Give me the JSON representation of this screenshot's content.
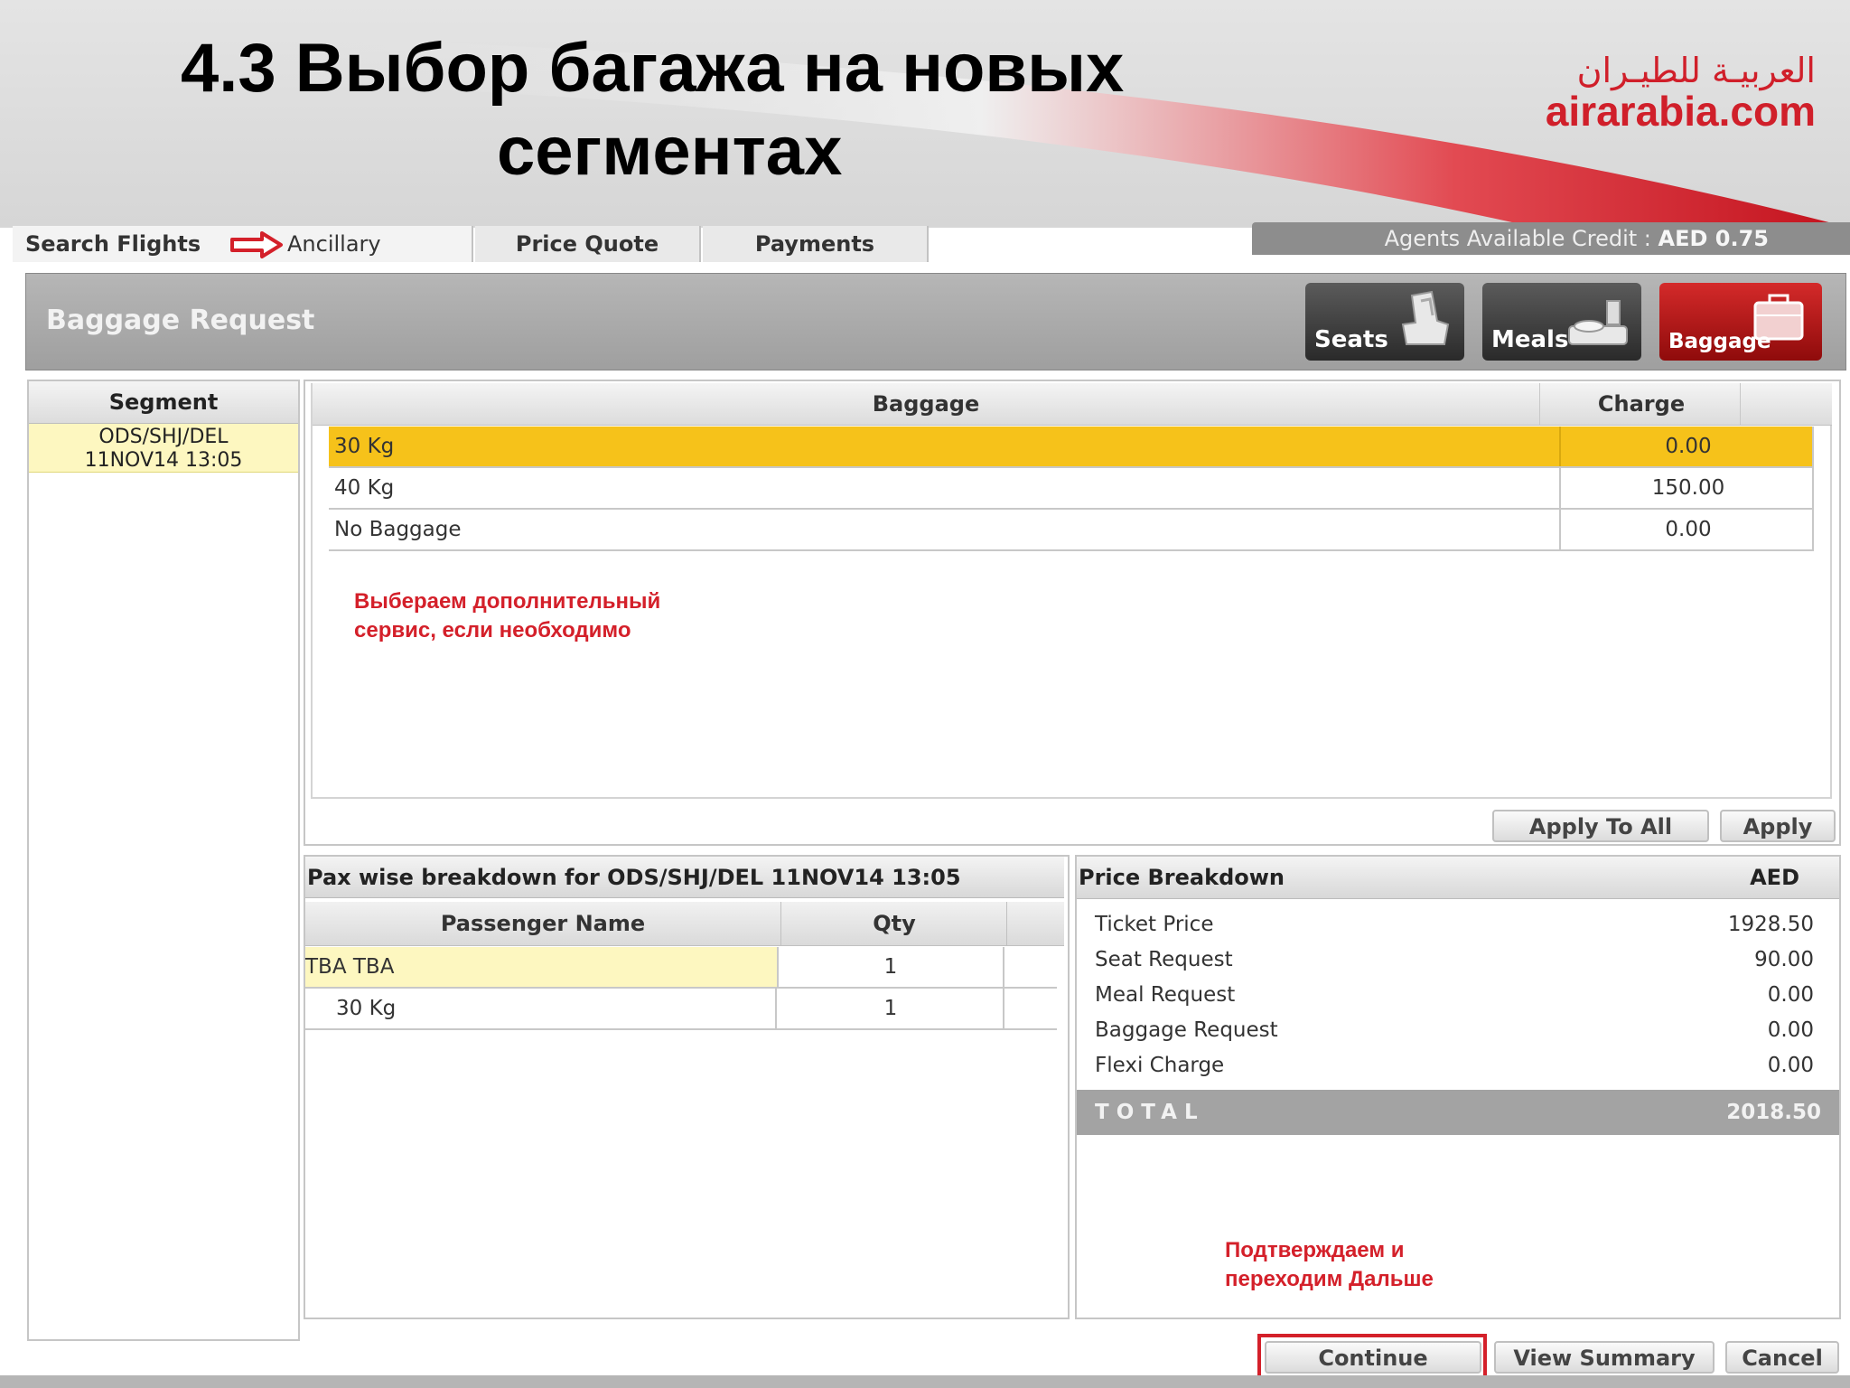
{
  "slide": {
    "title_line1": "4.3 Выбор багажа на новых",
    "title_line2": "сегментах"
  },
  "logo": {
    "arabic": "العربيـة للطيـران",
    "latin": "airarabia.com"
  },
  "tabs": {
    "search_flights": "Search Flights",
    "ancillary": "Ancillary",
    "price_quote": "Price Quote",
    "payments": "Payments"
  },
  "credit": {
    "label": "Agents Available Credit :",
    "value": "AED 0.75"
  },
  "request": {
    "title": "Baggage Request",
    "services": {
      "seats": "Seats",
      "meals": "Meals",
      "baggage": "Baggage"
    }
  },
  "segment": {
    "header": "Segment",
    "items": [
      {
        "route": "ODS/SHJ/DEL",
        "datetime": "11NOV14 13:05"
      }
    ]
  },
  "baggage": {
    "headers": {
      "baggage": "Baggage",
      "charge": "Charge"
    },
    "rows": [
      {
        "name": "30 Kg",
        "charge": "0.00",
        "selected": true
      },
      {
        "name": "40 Kg",
        "charge": "150.00",
        "selected": false
      },
      {
        "name": "No Baggage",
        "charge": "0.00",
        "selected": false
      }
    ],
    "note_line1": "Выбераем дополнительный",
    "note_line2": "сервис, если необходимо",
    "apply_to_all": "Apply To All",
    "apply": "Apply"
  },
  "pax": {
    "title": "Pax wise breakdown for ODS/SHJ/DEL 11NOV14 13:05",
    "headers": {
      "name": "Passenger Name",
      "qty": "Qty"
    },
    "rows": [
      {
        "name": "TBA TBA",
        "qty": "1"
      },
      {
        "name": "30 Kg",
        "qty": "1"
      }
    ]
  },
  "price": {
    "title": "Price Breakdown",
    "currency": "AED",
    "rows": [
      {
        "label": "Ticket Price",
        "value": "1928.50"
      },
      {
        "label": "Seat Request",
        "value": "90.00"
      },
      {
        "label": "Meal Request",
        "value": "0.00"
      },
      {
        "label": "Baggage Request",
        "value": "0.00"
      },
      {
        "label": "Flexi Charge",
        "value": "0.00"
      }
    ],
    "total_label": "TOTAL",
    "total_value": "2018.50",
    "note_line1": "Подтверждаем и",
    "note_line2": "переходим Дальше"
  },
  "footer_buttons": {
    "continue": "Continue",
    "view_summary": "View Summary",
    "cancel": "Cancel"
  },
  "colors": {
    "accent_red": "#d4202a",
    "selected_row": "#f6c21a",
    "highlight_yellow": "#fdf7c0"
  }
}
